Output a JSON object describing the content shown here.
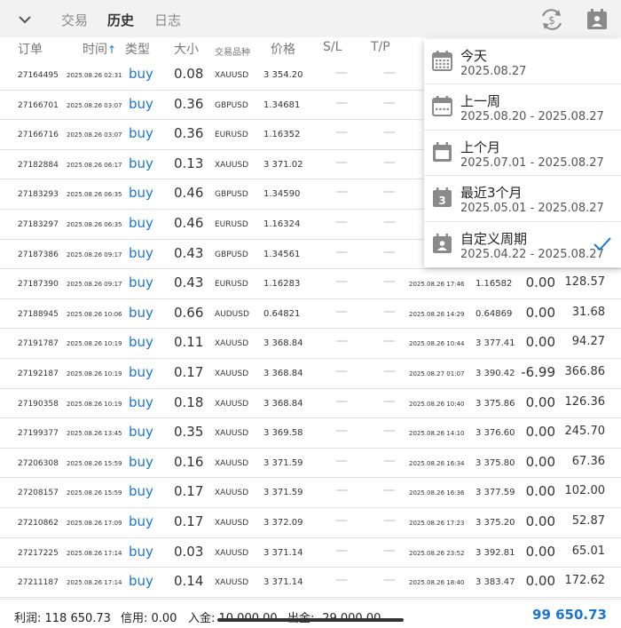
{
  "tabs": {
    "trade": "交易",
    "history": "历史",
    "journal": "日志"
  },
  "columns": {
    "order": "订单",
    "time": "时间",
    "type": "类型",
    "size": "大小",
    "symbol": "交易品种",
    "price": "价格",
    "sl": "S/L",
    "tp": "T/P"
  },
  "rows": [
    {
      "order": "27164495",
      "time": "2025.08.26 02:31",
      "type": "buy",
      "size": "0.08",
      "symbol": "XAUUSD",
      "price": "3 354.20",
      "sl": "—",
      "tp": "—",
      "close_time": "",
      "close_price": "",
      "swap": "",
      "profit": ""
    },
    {
      "order": "27166701",
      "time": "2025.08.26 03:07",
      "type": "buy",
      "size": "0.36",
      "symbol": "GBPUSD",
      "price": "1.34681",
      "sl": "—",
      "tp": "—",
      "close_time": "",
      "close_price": "",
      "swap": "",
      "profit": ""
    },
    {
      "order": "27166716",
      "time": "2025.08.26 03:07",
      "type": "buy",
      "size": "0.36",
      "symbol": "EURUSD",
      "price": "1.16352",
      "sl": "—",
      "tp": "—",
      "close_time": "",
      "close_price": "",
      "swap": "",
      "profit": ""
    },
    {
      "order": "27182884",
      "time": "2025.08.26 06:17",
      "type": "buy",
      "size": "0.13",
      "symbol": "XAUUSD",
      "price": "3 371.02",
      "sl": "—",
      "tp": "—",
      "close_time": "",
      "close_price": "",
      "swap": "",
      "profit": ""
    },
    {
      "order": "27183293",
      "time": "2025.08.26 06:35",
      "type": "buy",
      "size": "0.46",
      "symbol": "GBPUSD",
      "price": "1.34590",
      "sl": "—",
      "tp": "—",
      "close_time": "",
      "close_price": "",
      "swap": "",
      "profit": ""
    },
    {
      "order": "27183297",
      "time": "2025.08.26 06:35",
      "type": "buy",
      "size": "0.46",
      "symbol": "EURUSD",
      "price": "1.16324",
      "sl": "—",
      "tp": "—",
      "close_time": "",
      "close_price": "",
      "swap": "",
      "profit": ""
    },
    {
      "order": "27187386",
      "time": "2025.08.26 09:17",
      "type": "buy",
      "size": "0.43",
      "symbol": "GBPUSD",
      "price": "1.34561",
      "sl": "—",
      "tp": "—",
      "close_time": "",
      "close_price": "",
      "swap": "",
      "profit": ""
    },
    {
      "order": "27187390",
      "time": "2025.08.26 09:17",
      "type": "buy",
      "size": "0.43",
      "symbol": "EURUSD",
      "price": "1.16283",
      "sl": "—",
      "tp": "—",
      "close_time": "2025.08.26 17:46",
      "close_price": "1.16582",
      "swap": "0.00",
      "profit": "128.57"
    },
    {
      "order": "27188945",
      "time": "2025.08.26 10:06",
      "type": "buy",
      "size": "0.66",
      "symbol": "AUDUSD",
      "price": "0.64821",
      "sl": "—",
      "tp": "—",
      "close_time": "2025.08.26 14:29",
      "close_price": "0.64869",
      "swap": "0.00",
      "profit": "31.68"
    },
    {
      "order": "27191787",
      "time": "2025.08.26 10:19",
      "type": "buy",
      "size": "0.11",
      "symbol": "XAUUSD",
      "price": "3 368.84",
      "sl": "—",
      "tp": "—",
      "close_time": "2025.08.26 10:44",
      "close_price": "3 377.41",
      "swap": "0.00",
      "profit": "94.27"
    },
    {
      "order": "27192187",
      "time": "2025.08.26 10:19",
      "type": "buy",
      "size": "0.17",
      "symbol": "XAUUSD",
      "price": "3 368.84",
      "sl": "—",
      "tp": "—",
      "close_time": "2025.08.27 01:07",
      "close_price": "3 390.42",
      "swap": "-6.99",
      "profit": "366.86"
    },
    {
      "order": "27190358",
      "time": "2025.08.26 10:19",
      "type": "buy",
      "size": "0.18",
      "symbol": "XAUUSD",
      "price": "3 368.84",
      "sl": "—",
      "tp": "—",
      "close_time": "2025.08.26 10:40",
      "close_price": "3 375.86",
      "swap": "0.00",
      "profit": "126.36"
    },
    {
      "order": "27199377",
      "time": "2025.08.26 13:45",
      "type": "buy",
      "size": "0.35",
      "symbol": "XAUUSD",
      "price": "3 369.58",
      "sl": "—",
      "tp": "—",
      "close_time": "2025.08.26 14:10",
      "close_price": "3 376.60",
      "swap": "0.00",
      "profit": "245.70"
    },
    {
      "order": "27206308",
      "time": "2025.08.26 15:59",
      "type": "buy",
      "size": "0.16",
      "symbol": "XAUUSD",
      "price": "3 371.59",
      "sl": "—",
      "tp": "—",
      "close_time": "2025.08.26 16:34",
      "close_price": "3 375.80",
      "swap": "0.00",
      "profit": "67.36"
    },
    {
      "order": "27208157",
      "time": "2025.08.26 15:59",
      "type": "buy",
      "size": "0.17",
      "symbol": "XAUUSD",
      "price": "3 371.59",
      "sl": "—",
      "tp": "—",
      "close_time": "2025.08.26 16:36",
      "close_price": "3 377.59",
      "swap": "0.00",
      "profit": "102.00"
    },
    {
      "order": "27210862",
      "time": "2025.08.26 17:09",
      "type": "buy",
      "size": "0.17",
      "symbol": "XAUUSD",
      "price": "3 372.09",
      "sl": "—",
      "tp": "—",
      "close_time": "2025.08.26 17:23",
      "close_price": "3 375.20",
      "swap": "0.00",
      "profit": "52.87"
    },
    {
      "order": "27217225",
      "time": "2025.08.26 17:14",
      "type": "buy",
      "size": "0.03",
      "symbol": "XAUUSD",
      "price": "3 371.14",
      "sl": "—",
      "tp": "—",
      "close_time": "2025.08.26 23:52",
      "close_price": "3 392.81",
      "swap": "0.00",
      "profit": "65.01"
    },
    {
      "order": "27211187",
      "time": "2025.08.26 17:14",
      "type": "buy",
      "size": "0.14",
      "symbol": "XAUUSD",
      "price": "3 371.14",
      "sl": "—",
      "tp": "—",
      "close_time": "2025.08.26 18:40",
      "close_price": "3 383.47",
      "swap": "0.00",
      "profit": "172.62"
    }
  ],
  "footer": {
    "profit_label": "利润: 118 650.73",
    "credit_label": "信用: 0.00",
    "deposit_label": "入金: 10 000.00",
    "withdraw_label": "出金: -29 000.00",
    "balance": "99 650.73"
  },
  "period_menu": [
    {
      "title": "今天",
      "range": "2025.08.27",
      "icon": "calendar-today-icon",
      "selected": false
    },
    {
      "title": "上一周",
      "range": "2025.08.20 - 2025.08.27",
      "icon": "calendar-week-icon",
      "selected": false
    },
    {
      "title": "上个月",
      "range": "2025.07.01 - 2025.08.27",
      "icon": "calendar-month-icon",
      "selected": false
    },
    {
      "title": "最近3个月",
      "range": "2025.05.01 - 2025.08.27",
      "icon": "calendar-3-months-icon",
      "selected": false
    },
    {
      "title": "自定义周期",
      "range": "2025.04.22 - 2025.08.27",
      "icon": "calendar-custom-icon",
      "selected": true
    }
  ],
  "colors": {
    "accent": "#1a76d2",
    "icon_gray": "#8a8a8a",
    "topbar_bg": "#f2f2f2"
  }
}
